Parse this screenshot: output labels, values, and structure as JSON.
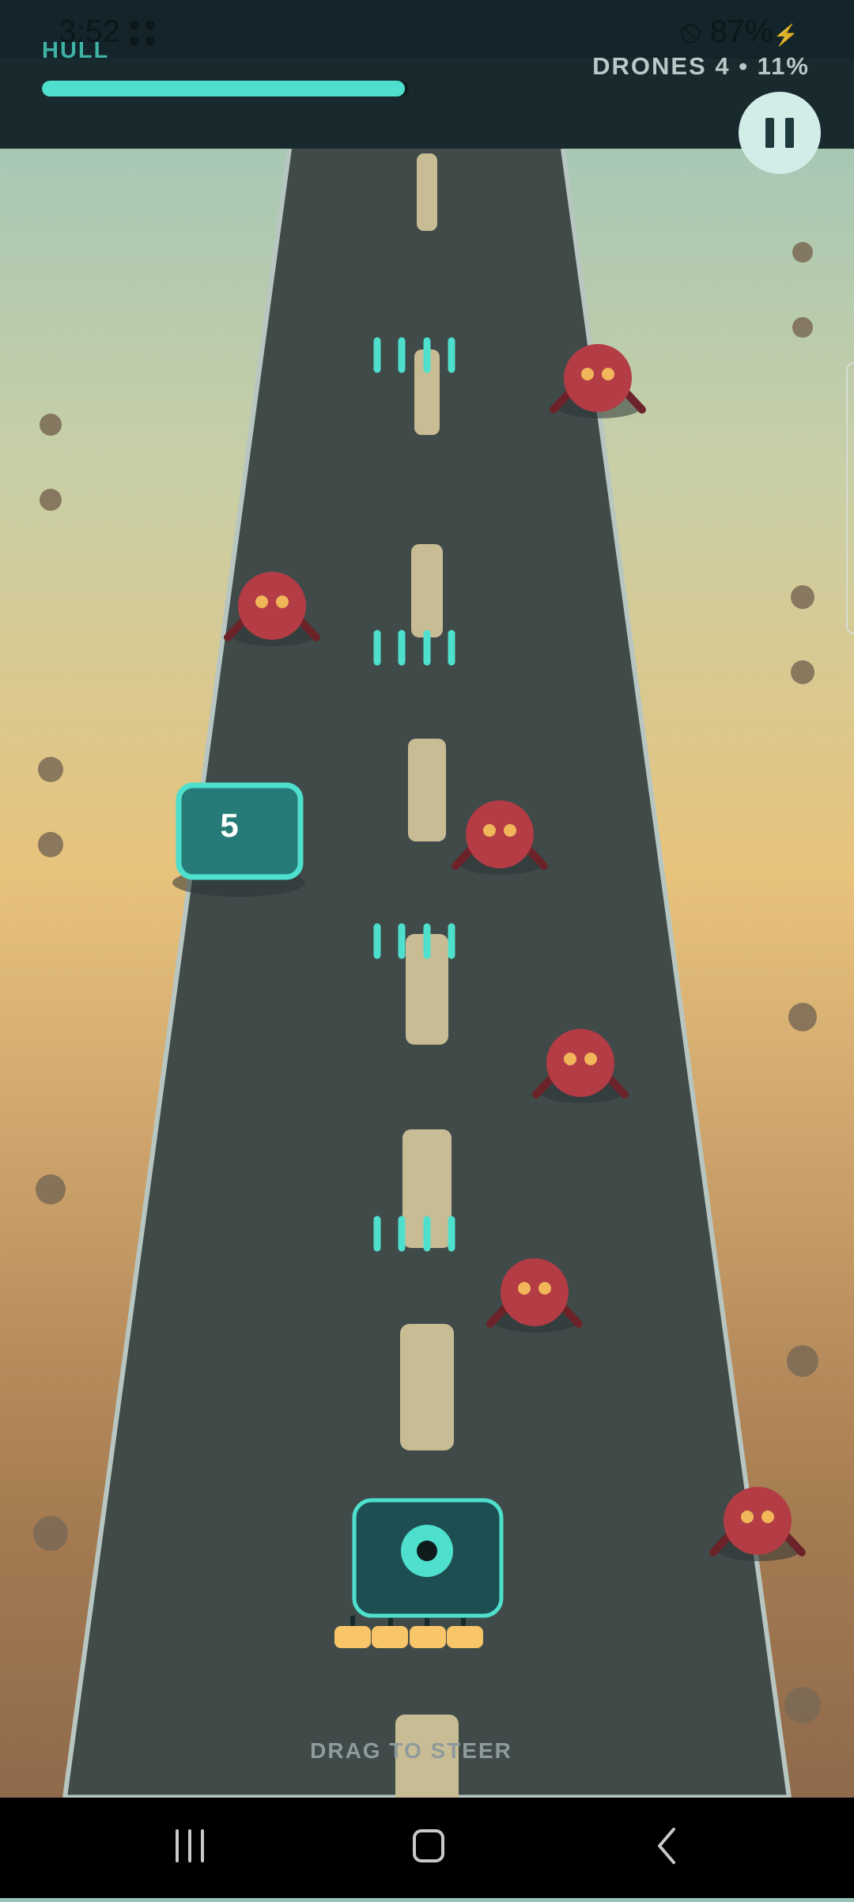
{
  "status_bar": {
    "time": "3:52",
    "battery": "87%"
  },
  "hud": {
    "hull_label": "HULL",
    "hull_fraction": 0.99,
    "drones_readout": "DRONES 4 • 11%"
  },
  "pickup": {
    "value": "5"
  },
  "hint": "DRAG TO STEER",
  "icons": {
    "pause": "pause-icon",
    "nav_recent": "recent-apps-icon",
    "nav_home": "home-icon",
    "nav_back": "back-icon"
  },
  "colors": {
    "road": "#3f4a49",
    "hull_bar": "#4ee0cd",
    "player_body": "#1d4f52",
    "player_accent": "#4ee0cd",
    "drone": "#b33c45",
    "drone_eye": "#f2b65a",
    "thruster": "#f8c568",
    "lane_marker": "#c8bc95"
  }
}
